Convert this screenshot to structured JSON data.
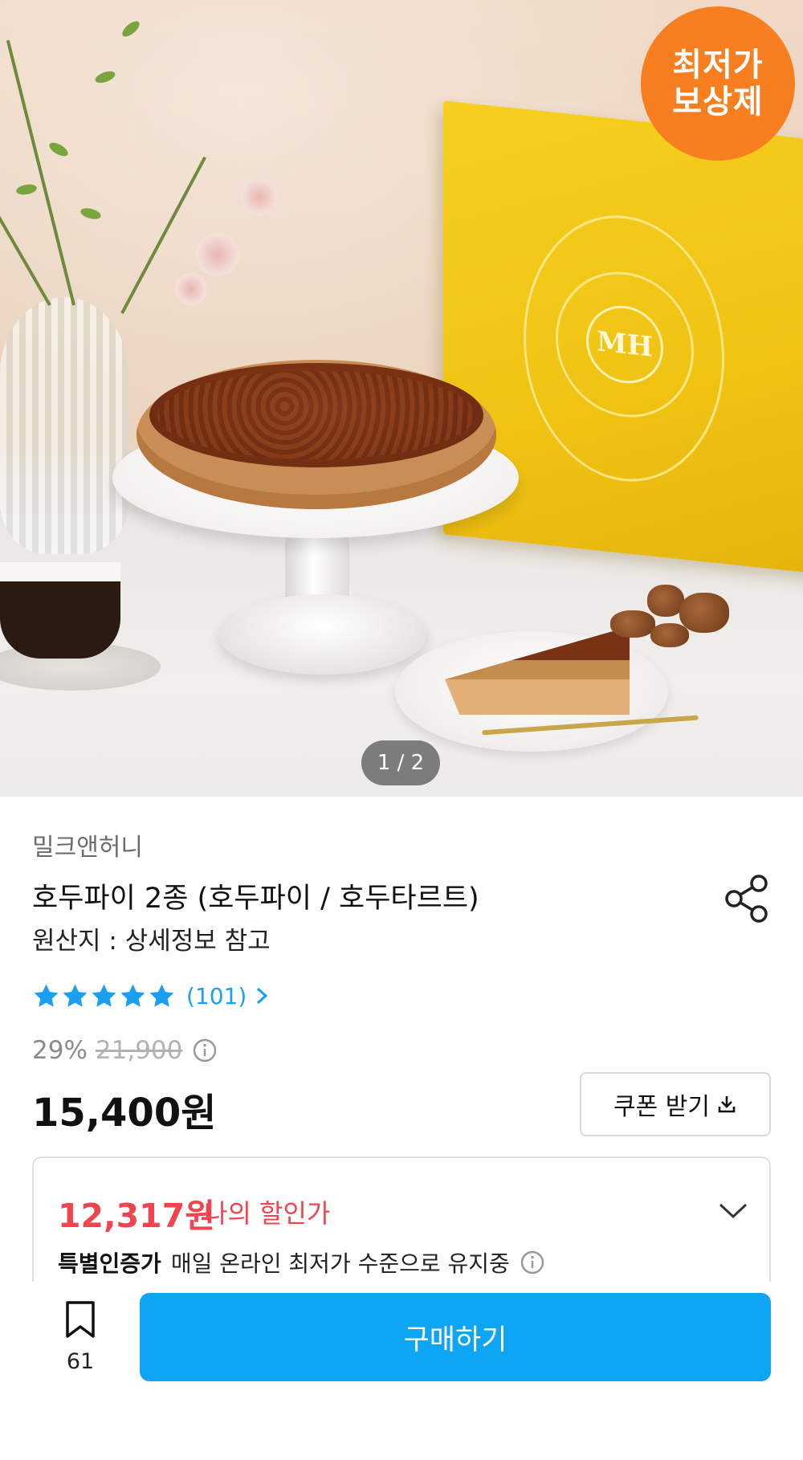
{
  "product_image": {
    "badge_lines": [
      "최저가",
      "보상제"
    ],
    "box_logo": "MH",
    "pager": "1 / 2"
  },
  "product": {
    "brand": "밀크앤허니",
    "title": "호두파이 2종 (호두파이 / 호두타르트)",
    "origin": "원산지 : 상세정보 참고",
    "rating_stars": 5,
    "review_count": "(101)",
    "discount_rate": "29%",
    "original_price": "21,900",
    "price": "15,400원"
  },
  "coupon": {
    "label": "쿠폰 받기"
  },
  "deal": {
    "my_price": "12,317원",
    "my_price_label": "나의 할인가",
    "cert_strong": "특별인증가",
    "cert_text": "매일 온라인 최저가 수준으로 유지중"
  },
  "bottom_bar": {
    "bookmark_count": "61",
    "buy_label": "구매하기"
  },
  "colors": {
    "badge": "#f77f20",
    "accent_blue": "#0fa5f5",
    "star_blue": "#1aa0f0",
    "discount_red": "#f2434f"
  },
  "icons": [
    "share-icon",
    "star-icon",
    "chevron-right-icon",
    "info-icon",
    "download-icon",
    "chevron-down-icon",
    "bookmark-icon"
  ]
}
